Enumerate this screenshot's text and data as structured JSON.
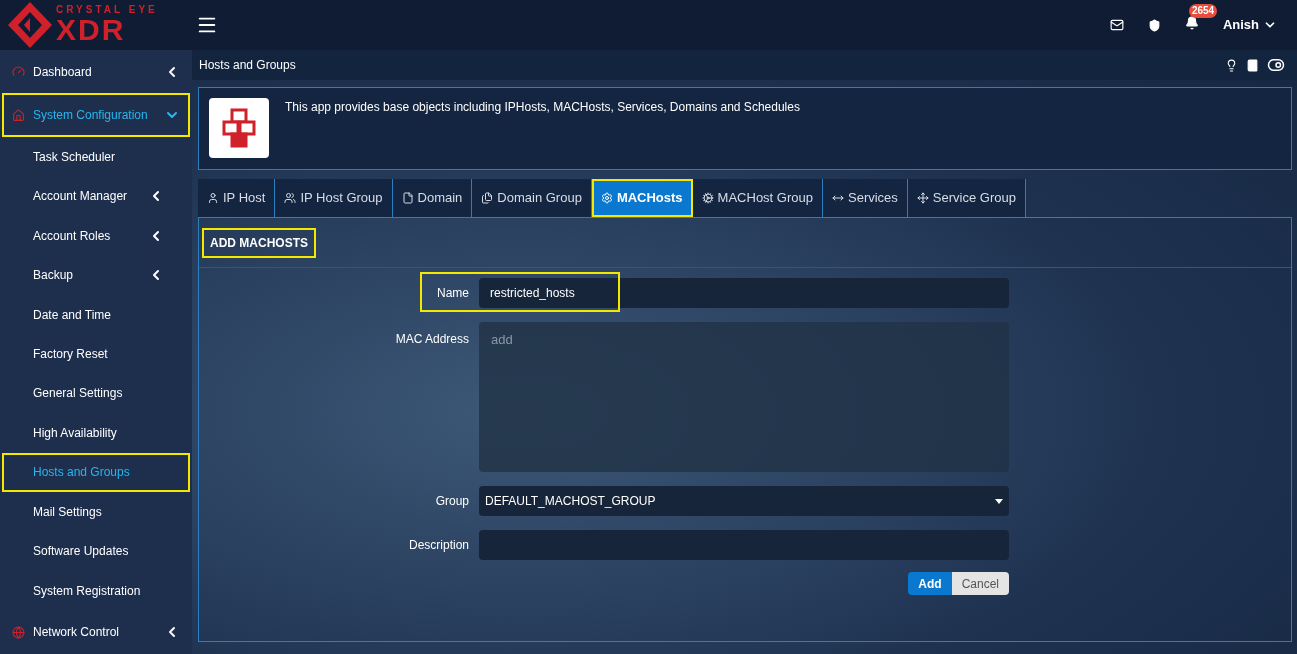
{
  "header": {
    "logo_top": "CRYSTAL EYE",
    "logo_main": "XDR",
    "notifications": "2654",
    "user": "Anish"
  },
  "sidebar": {
    "items": [
      {
        "label": "Dashboard",
        "expanded": false,
        "selected": false,
        "highlighted": false
      },
      {
        "label": "System Configuration",
        "expanded": true,
        "selected": true,
        "highlighted": true,
        "children": [
          {
            "label": "Task Scheduler",
            "has_submenu": false,
            "selected": false,
            "highlighted": false
          },
          {
            "label": "Account Manager",
            "has_submenu": true,
            "selected": false,
            "highlighted": false
          },
          {
            "label": "Account Roles",
            "has_submenu": true,
            "selected": false,
            "highlighted": false
          },
          {
            "label": "Backup",
            "has_submenu": true,
            "selected": false,
            "highlighted": false
          },
          {
            "label": "Date and Time",
            "has_submenu": false,
            "selected": false,
            "highlighted": false
          },
          {
            "label": "Factory Reset",
            "has_submenu": false,
            "selected": false,
            "highlighted": false
          },
          {
            "label": "General Settings",
            "has_submenu": false,
            "selected": false,
            "highlighted": false
          },
          {
            "label": "High Availability",
            "has_submenu": false,
            "selected": false,
            "highlighted": false
          },
          {
            "label": "Hosts and Groups",
            "has_submenu": false,
            "selected": true,
            "highlighted": true
          },
          {
            "label": "Mail Settings",
            "has_submenu": false,
            "selected": false,
            "highlighted": false
          },
          {
            "label": "Software Updates",
            "has_submenu": false,
            "selected": false,
            "highlighted": false
          },
          {
            "label": "System Registration",
            "has_submenu": false,
            "selected": false,
            "highlighted": false
          }
        ]
      },
      {
        "label": "Network Control",
        "expanded": false,
        "selected": false,
        "highlighted": false
      }
    ]
  },
  "page": {
    "title": "Hosts and Groups",
    "app_description": "This app provides base objects including IPHosts, MACHosts, Services, Domains and Schedules"
  },
  "tabs": [
    {
      "label": "IP Host",
      "selected": false,
      "highlighted": false
    },
    {
      "label": "IP Host Group",
      "selected": false,
      "highlighted": false
    },
    {
      "label": "Domain",
      "selected": false,
      "highlighted": false
    },
    {
      "label": "Domain Group",
      "selected": false,
      "highlighted": false
    },
    {
      "label": "MACHosts",
      "selected": true,
      "highlighted": true
    },
    {
      "label": "MACHost Group",
      "selected": false,
      "highlighted": false
    },
    {
      "label": "Services",
      "selected": false,
      "highlighted": false
    },
    {
      "label": "Service Group",
      "selected": false,
      "highlighted": false
    }
  ],
  "form": {
    "title": "ADD MACHOSTS",
    "title_highlighted": true,
    "fields": [
      {
        "kind": "text",
        "label": "Name",
        "value": "restricted_hosts",
        "highlighted": true
      },
      {
        "kind": "textarea",
        "label": "MAC Address",
        "placeholder": "add",
        "highlighted": false
      },
      {
        "kind": "select",
        "label": "Group",
        "value": "DEFAULT_MACHOST_GROUP",
        "highlighted": false
      },
      {
        "kind": "text",
        "label": "Description",
        "highlighted": false
      }
    ],
    "buttons": [
      {
        "label": "Add",
        "kind": "primary"
      },
      {
        "label": "Cancel",
        "kind": "secondary"
      }
    ]
  }
}
